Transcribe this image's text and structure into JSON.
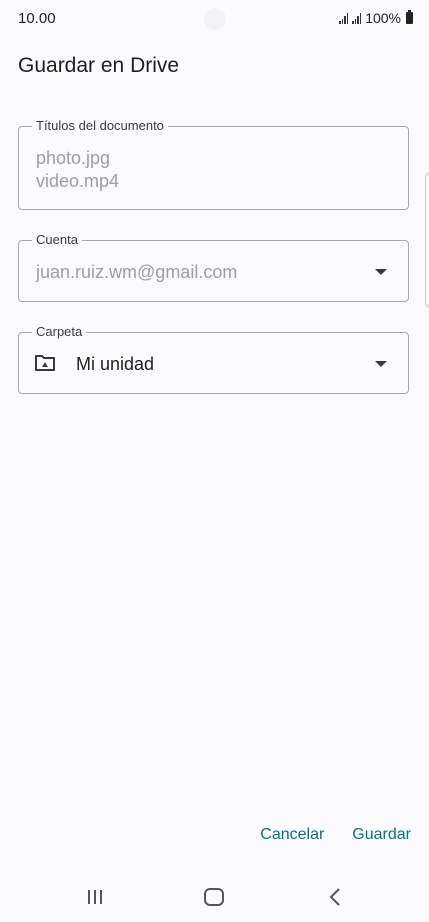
{
  "status": {
    "time": "10.00",
    "battery": "100%"
  },
  "title": "Guardar en Drive",
  "titles_field": {
    "label": "Títulos del documento",
    "values": [
      "photo.jpg",
      "video.mp4"
    ]
  },
  "account_field": {
    "label": "Cuenta",
    "value": "juan.ruiz.wm@gmail.com"
  },
  "folder_field": {
    "label": "Carpeta",
    "value": "Mi unidad"
  },
  "actions": {
    "cancel": "Cancelar",
    "save": "Guardar"
  },
  "colors": {
    "accent": "#0b6e8e",
    "background": "#fbfbfd",
    "outline": "#a9a9ad",
    "muted_text": "#9e9ea3"
  }
}
